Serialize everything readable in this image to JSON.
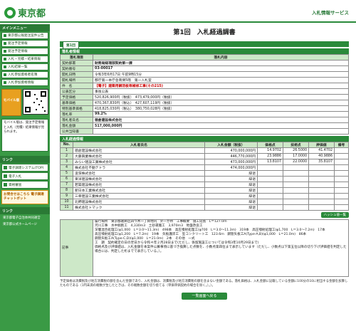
{
  "header": {
    "logo": "東京都",
    "service": "入札情報サービス"
  },
  "sidebar": {
    "menu_title": "メインメニュー",
    "items": [
      "東京都公報発注案件公告",
      "発注予定情報",
      "発注予定情報",
      "入札・見積・結果情報",
      "入札結果一覧",
      "入札参加資格者名簿",
      "入札参加資格情報"
    ],
    "mobile_label": "モバイル版",
    "mobile_note": "モバイル版は、発注予定情報と入札（見積）結果情報が見られます。",
    "links_title": "リンク",
    "links": [
      "電子調達システム(TOP)",
      "電子入札",
      "資格審査"
    ],
    "orange": "お問合せはこちら 電子調達チャットボット",
    "bottom_title": "リンク",
    "bottom_links": [
      "東京都電子自治体共同運営",
      "東京都公式ホームページ"
    ]
  },
  "page": {
    "title": "第1回　入札経過調書",
    "round_tab": "第1回"
  },
  "summary": {
    "section": "落札者情報",
    "col_item": "落札項目",
    "col_content": "落札内容",
    "rows": [
      {
        "label": "契約部署",
        "value": "財務局経理部契約第一課"
      },
      {
        "label": "契約番号",
        "value": "03-00017"
      },
      {
        "label": "開札日時",
        "value": "令和3年6月17日 午前9時15分"
      },
      {
        "label": "開札場所",
        "value": "都庁第一本庁舎南側5階　第一入札室"
      },
      {
        "label": "件　名",
        "value": "【電子】建築用鋼羽板等補修工事(その215)"
      },
      {
        "label": "公表区分",
        "value": "事後公表"
      },
      {
        "label": "予定価格",
        "value": "520,826,900円（税抜）　473,479,000円（税抜）"
      },
      {
        "label": "基準価格",
        "value": "470,367,830円（税込）　427,607,119円（税抜）"
      },
      {
        "label": "特別基準価格",
        "value": "418,825,030円（税込）　380,750,028円（税抜）"
      },
      {
        "label": "落札率",
        "value": "99.2%"
      },
      {
        "label": "落札者氏名",
        "value": "徳倉建設株式会社"
      },
      {
        "label": "落札金額",
        "value": "517,000,000円"
      },
      {
        "label": "公共当知書",
        "value": ""
      }
    ]
  },
  "bids": {
    "section": "入札経過情報",
    "headers": [
      "No.",
      "入札者氏名",
      "入札金額（税抜）",
      "価格点",
      "技術点",
      "評価値",
      "備考"
    ],
    "rows": [
      [
        "1",
        "徳倉建設株式会社",
        "470,000,000円",
        "14.9702",
        "26.5000",
        "41.4702",
        ""
      ],
      [
        "2",
        "大藤興業株式会社",
        "446,770,000円",
        "23.9886",
        "17.0000",
        "40.9886",
        ""
      ],
      [
        "3",
        "みらい建設工業株式会社",
        "473,000,000円",
        "13.8107",
        "22.0000",
        "35.8107",
        ""
      ],
      [
        "4",
        "株式会社不動テトラ",
        "474,000,000円",
        "",
        "",
        "",
        ""
      ],
      [
        "5",
        "浚渫株式会社",
        "辞退",
        "",
        "",
        "",
        ""
      ],
      [
        "6",
        "東洋建設株式会社",
        "辞退",
        "",
        "",
        "",
        ""
      ],
      [
        "7",
        "若築建設株式会社",
        "辞退",
        "",
        "",
        "",
        ""
      ],
      [
        "8",
        "新日本工業株式会社",
        "辞退",
        "",
        "",
        "",
        ""
      ],
      [
        "9",
        "三幸建設工業株式会社",
        "辞退",
        "",
        "",
        "",
        ""
      ],
      [
        "10",
        "北野建設株式会社",
        "辞退",
        "",
        "",
        "",
        ""
      ],
      [
        "11",
        "株式会社トマック",
        "辞退",
        "",
        "",
        "",
        ""
      ]
    ],
    "hash_button": "ハッシュ値一覧"
  },
  "remarks": {
    "label": "記事",
    "text": "履行場所　東京都葛飾区四つ木一丁目地内　外一か所　工事概要　施工延長　L＝127.0m\n河川工事　水中掘削工　4,330ｍ3　土砂運搬工　3,970ｍ3　地盤改良工\n深層混合処理工(φ1,000　L＝3.0〜11.3m)　498本　高圧噴射処理工(φ700　L＝3.0〜11.3m)　319本　高圧噴射処理工(φ1,700　L＝3.0〜7.2m)　17本\n高圧噴射処理工(φ1,200　L＝7.2m)　19本　矢板護岸工　笠コンクリート工　123.6ｍ　鋼管矢板工A(Type-A,B)(φ1,000　L＝21.0m)　86本\n鋼管矢板工A(Type-C,D)(φ1,000　L＝21.0m)　2本　その他　一式\n工　期　契約確定の日の翌日から令和４年２月28日まで(ただし、係留施設工については令和3年10月29日まで)\n価格点及び評価値は、入札金額を本案件公募事項に基づき換算した点数を、小数点第四位まで表示しています（ただし、小数点以下第五位以降の切り下げ評価値を判定した場合には、判定した桁までで表示している。）。"
  },
  "footer": {
    "notes": "予定価格は消費税及び地方消費税の額を含んだ金額であり、入札金額は、消費税及び地方消費税の額を含まない金額である。落札価格は、入札金額に記載している金額に100分の10に相当する金額を加算したものである（1円未満の端数が生じたときは、その端数金額を切り捨てる（単価単価契約の場合を除く。）。）。",
    "back_button": "一覧画面へ戻る"
  }
}
